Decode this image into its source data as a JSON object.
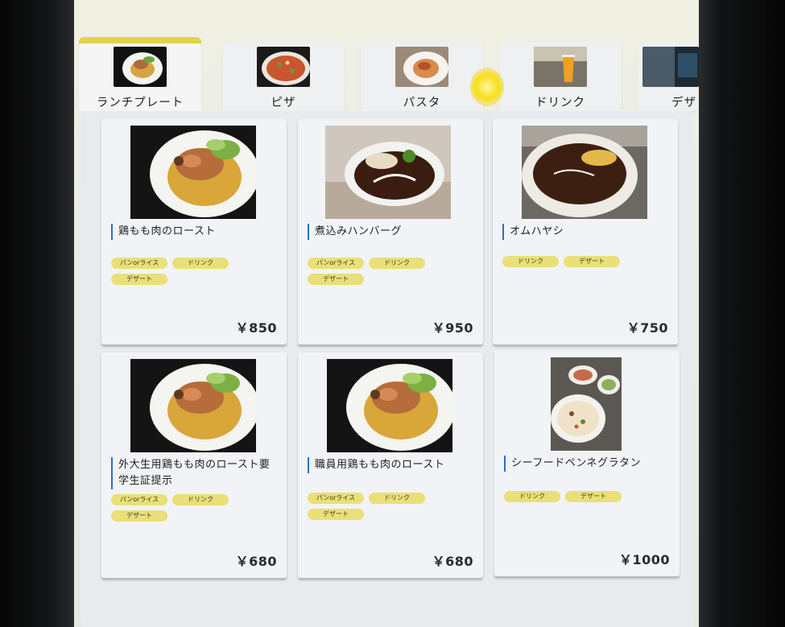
{
  "tabs": [
    {
      "label": "ランチプレート",
      "active": true,
      "thumb_icon": "lunch-plate-photo"
    },
    {
      "label": "ピザ",
      "active": false,
      "thumb_icon": "pizza-photo"
    },
    {
      "label": "パスタ",
      "active": false,
      "thumb_icon": "pasta-photo"
    },
    {
      "label": "ドリンク",
      "active": false,
      "thumb_icon": "drink-photo"
    },
    {
      "label": "デザ",
      "active": false,
      "thumb_icon": "dessert-photo"
    }
  ],
  "items": [
    {
      "name": "鶏もも肉のロースト",
      "tags": [
        "パンorライス",
        "ドリンク",
        "デザート"
      ],
      "price": "￥850",
      "photo_icon": "roast-chicken-photo"
    },
    {
      "name": "煮込みハンバーグ",
      "tags": [
        "パンorライス",
        "ドリンク",
        "デザート"
      ],
      "price": "￥950",
      "photo_icon": "hamburg-steak-photo"
    },
    {
      "name": "オムハヤシ",
      "tags": [
        "ドリンク",
        "デザート"
      ],
      "price": "￥750",
      "photo_icon": "omu-hayashi-photo"
    },
    {
      "name": "外大生用鶏もも肉のロースト要学生証提示",
      "tags": [
        "パンorライス",
        "ドリンク",
        "デザート"
      ],
      "price": "￥680",
      "photo_icon": "roast-chicken-photo"
    },
    {
      "name": "職員用鶏もも肉のロースト",
      "tags": [
        "パンorライス",
        "ドリンク",
        "デザート"
      ],
      "price": "￥680",
      "photo_icon": "roast-chicken-photo"
    },
    {
      "name": "シーフードペンネグラタン",
      "tags": [
        "ドリンク",
        "デザート"
      ],
      "price": "￥1000",
      "photo_icon": "seafood-gratin-photo"
    }
  ],
  "colors": {
    "accent_tab": "#e2d24a",
    "tag_bg": "#e9e077",
    "name_bar": "#2c6fbf",
    "card_bg": "#f1f3f6"
  }
}
